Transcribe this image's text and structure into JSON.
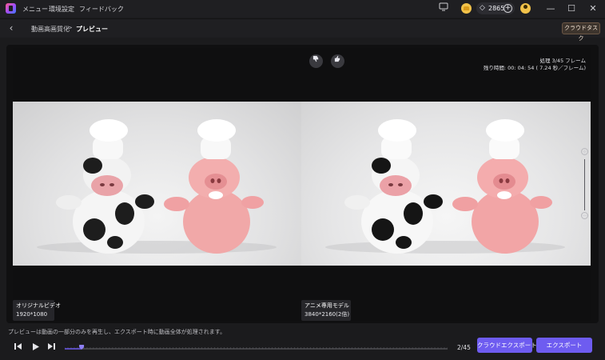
{
  "titlebar": {
    "menus": [
      "メニュー",
      "環境設定",
      "フィードバック"
    ],
    "credits": "2865",
    "icons": {
      "logo": "app-logo-icon",
      "screen": "monitor-icon",
      "coin": "coin-icon",
      "gem": "diamond-icon",
      "avatar": "user-icon",
      "add": "plus-icon"
    }
  },
  "header": {
    "breadcrumb_parent": "動画高画質化",
    "breadcrumb_separator": ">",
    "breadcrumb_current": "プレビュー",
    "cloud_task_label": "クラウドタスク"
  },
  "preview": {
    "status_processing": "処理 3/45 フレーム",
    "status_remaining": "残り時間: 00: 04: 54 ( 7.24 秒／フレーム)",
    "left_label_title": "オリジナルビデオ",
    "left_label_res": "1920*1080",
    "right_label_title": "アニメ専用モデル",
    "right_label_res": "3840*2160(2倍)"
  },
  "footer": {
    "notice": "プレビューは動画の一部分のみを再生し、エクスポート時に動画全体が処理されます。",
    "frame_counter": "2/45",
    "playback_progress": 0.044,
    "cloud_export_label": "クラウドエクスポート",
    "export_label": "エクスポート"
  },
  "colors": {
    "accent": "#6e5cf0",
    "background": "#1b1b1d",
    "panel": "#101011"
  }
}
